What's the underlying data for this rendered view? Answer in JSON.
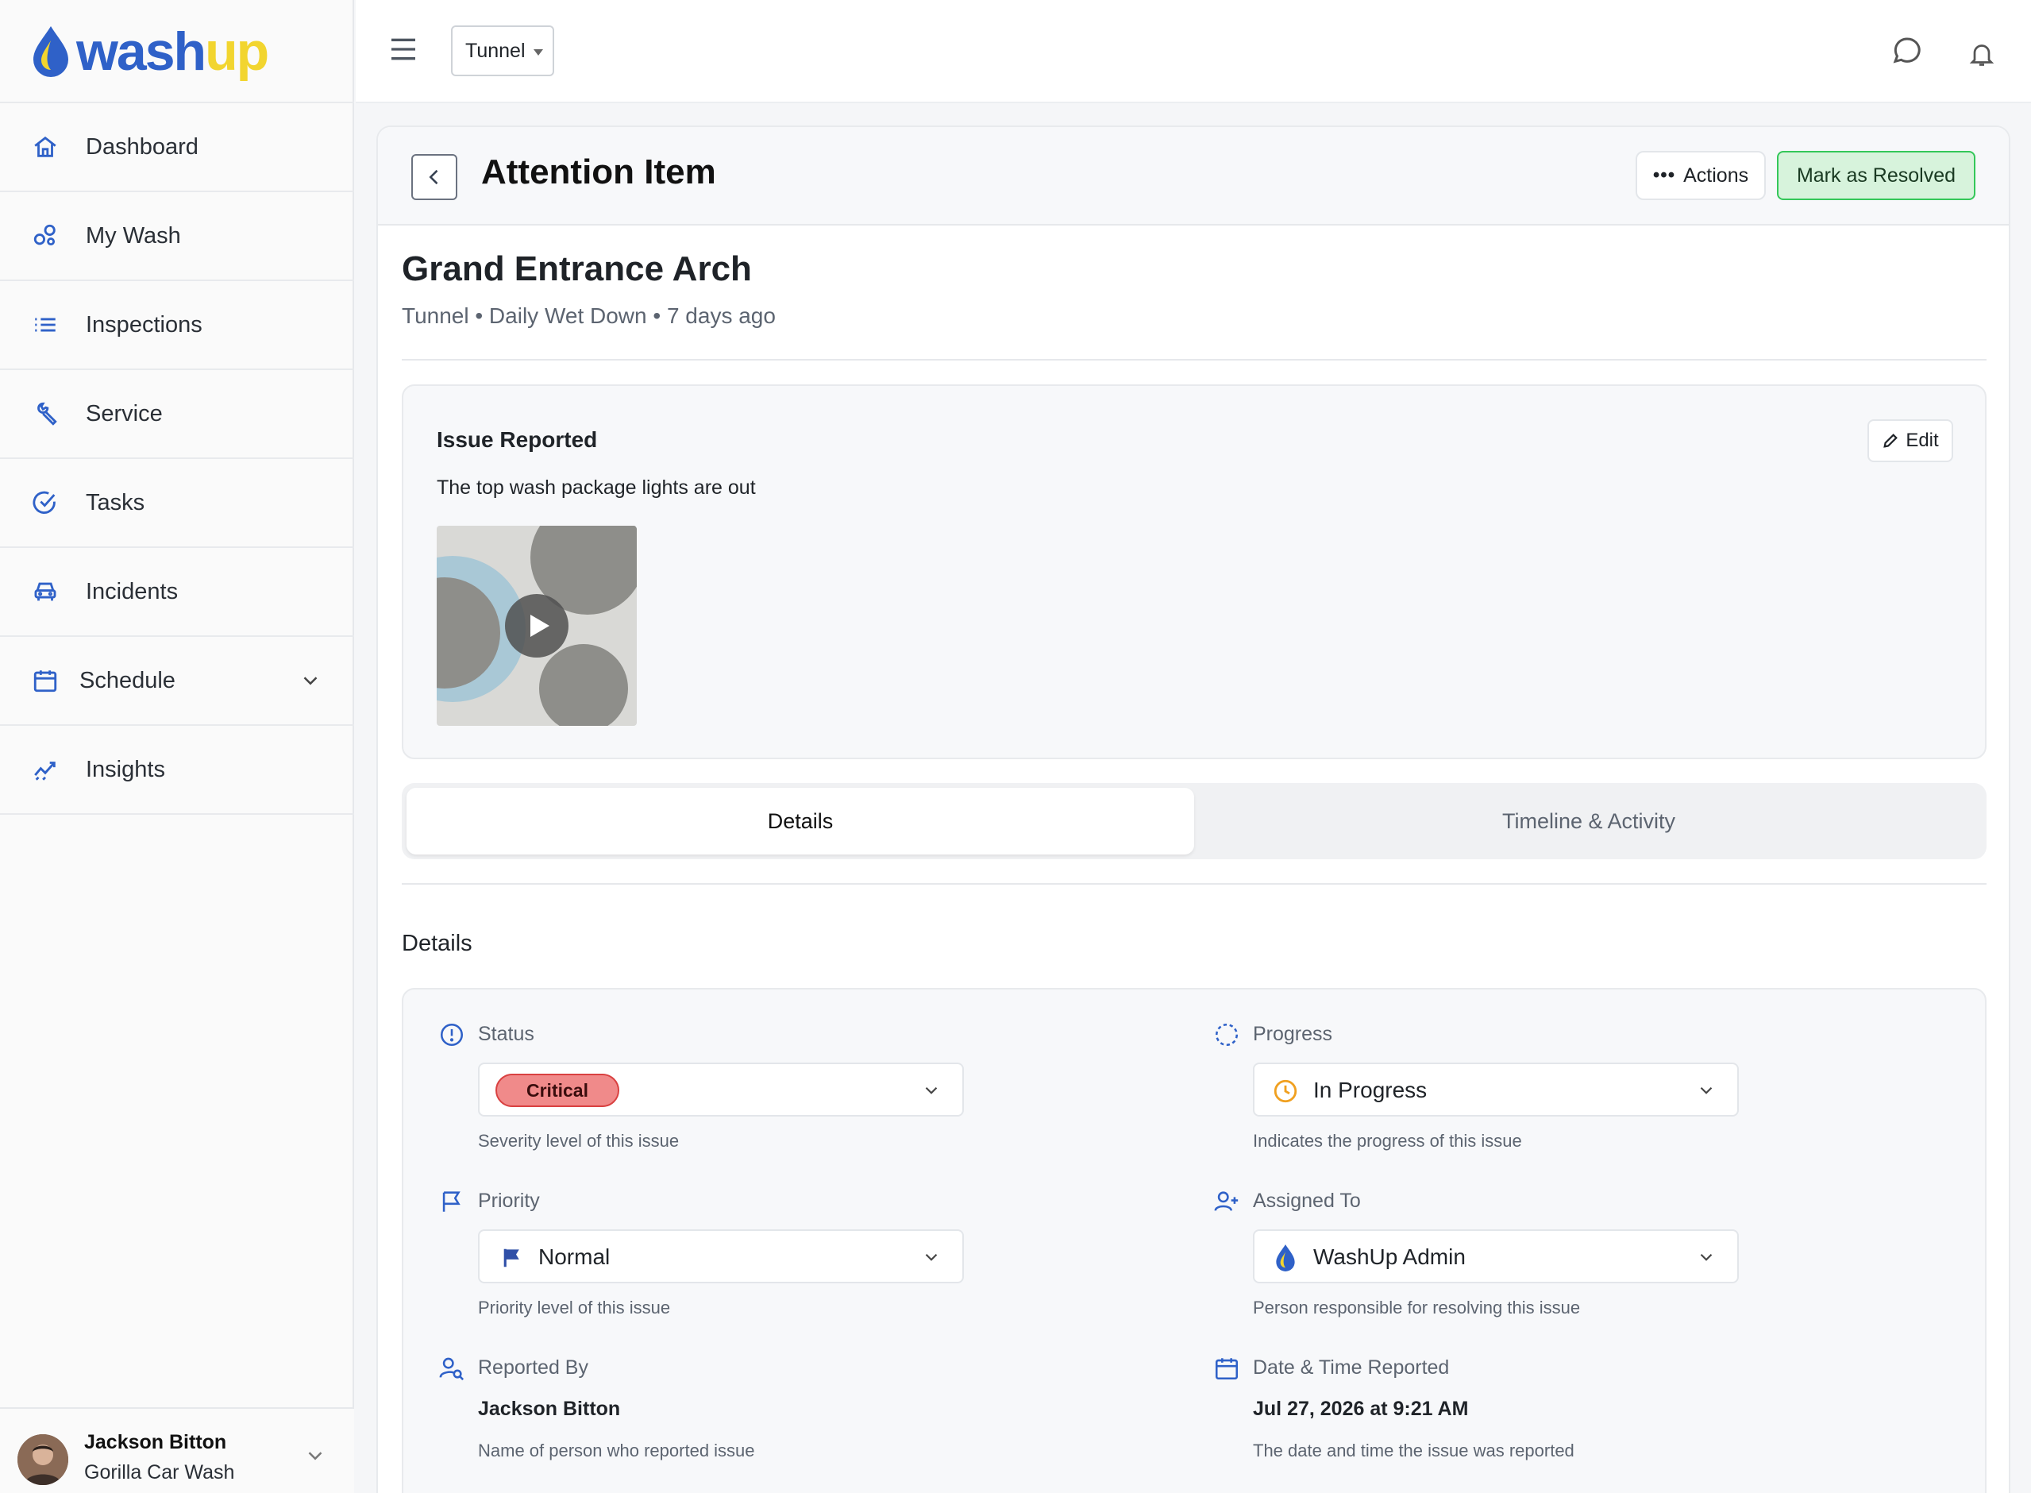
{
  "brand": {
    "logo_part1": "wash",
    "logo_part2": "up",
    "primary": "#2f61c8",
    "accent": "#f2d52f",
    "success": "#34c759",
    "danger": "#d94141"
  },
  "sidebar": {
    "items": [
      {
        "label": "Dashboard",
        "icon": "home-icon"
      },
      {
        "label": "My Wash",
        "icon": "my-wash-icon"
      },
      {
        "label": "Inspections",
        "icon": "list-icon"
      },
      {
        "label": "Service",
        "icon": "wrench-icon"
      },
      {
        "label": "Tasks",
        "icon": "check-circle-icon"
      },
      {
        "label": "Incidents",
        "icon": "car-icon"
      },
      {
        "label": "Schedule",
        "icon": "calendar-icon"
      },
      {
        "label": "Insights",
        "icon": "trend-icon"
      }
    ],
    "user": {
      "name": "Jackson Bitton",
      "org": "Gorilla Car Wash"
    }
  },
  "topbar": {
    "location": "Tunnel"
  },
  "header": {
    "title": "Attention Item",
    "actions_label": "Actions",
    "resolve_label": "Mark as Resolved"
  },
  "item": {
    "title": "Grand Entrance Arch",
    "meta": "Tunnel • Daily Wet Down • 7 days ago"
  },
  "issue": {
    "heading": "Issue Reported",
    "edit_label": "Edit",
    "description": "The top wash package lights are out"
  },
  "tabs": {
    "details": "Details",
    "timeline": "Timeline & Activity"
  },
  "details": {
    "title": "Details",
    "status": {
      "label": "Status",
      "value": "Critical",
      "helper": "Severity level of this issue"
    },
    "progress": {
      "label": "Progress",
      "value": "In Progress",
      "helper": "Indicates the progress of this issue"
    },
    "priority": {
      "label": "Priority",
      "value": "Normal",
      "helper": "Priority level of this issue"
    },
    "assigned": {
      "label": "Assigned To",
      "value": "WashUp Admin",
      "helper": "Person responsible for resolving this issue"
    },
    "reported_by": {
      "label": "Reported By",
      "value": "Jackson Bitton",
      "helper": "Name of person who reported issue"
    },
    "reported_at": {
      "label": "Date & Time Reported",
      "value": "Jul 27, 2026 at 9:21 AM",
      "helper": "The date and time the issue was reported"
    }
  }
}
